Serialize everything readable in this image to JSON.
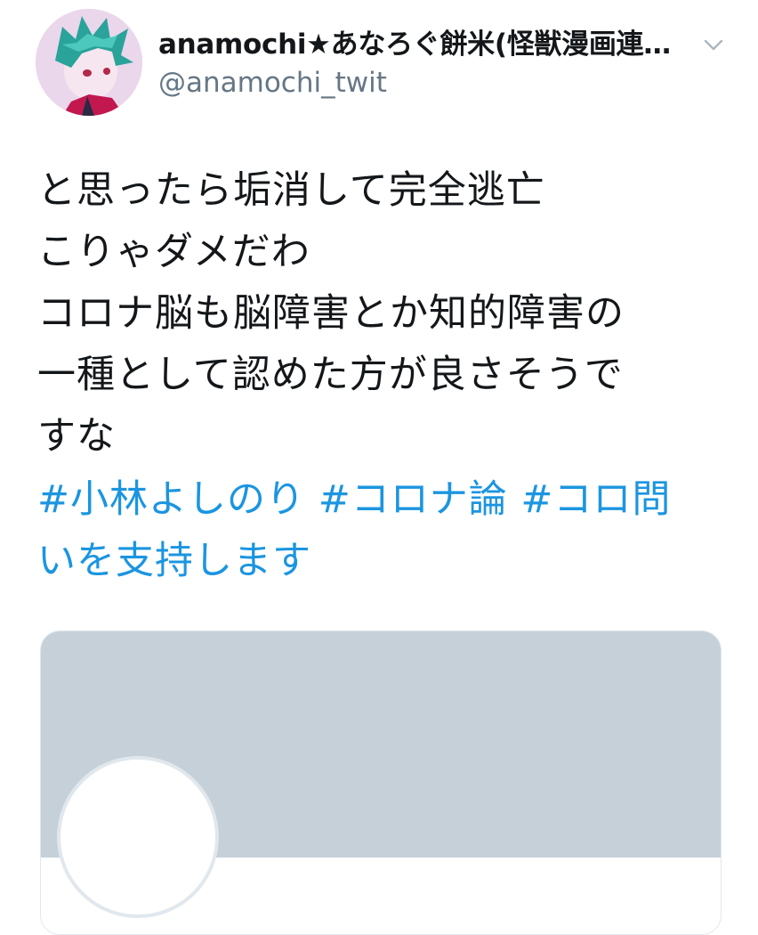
{
  "author": {
    "display_name": "anamochi★あなろぐ餅米(怪獣漫画連…",
    "handle": "@anamochi_twit",
    "avatar_icon": "user-avatar-icon"
  },
  "menu": {
    "caret_icon": "chevron-down-icon"
  },
  "tweet": {
    "lines": [
      "と思ったら垢消して完全逃亡",
      "こりゃダメだわ",
      "コロナ脳も脳障害とか知的障害の",
      "一種として認めた方が良さそうで",
      "すな"
    ],
    "hashtags": {
      "line1": [
        "#小林よしのり",
        "#コロナ論",
        "#コロ問"
      ],
      "line2": "いを支持します"
    }
  },
  "card": {
    "banner_color": "#c5d0d9"
  },
  "colors": {
    "link": "#1b95e0",
    "text": "#14171a",
    "secondary": "#657786"
  }
}
